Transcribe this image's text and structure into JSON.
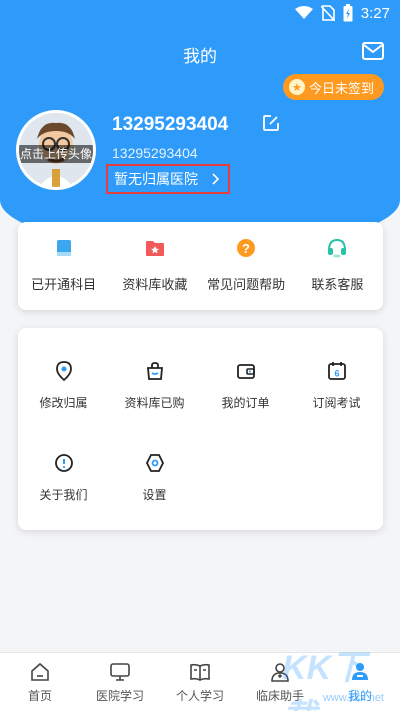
{
  "status_bar": {
    "time": "3:27"
  },
  "header": {
    "title": "我的",
    "signin_label": "今日未签到"
  },
  "profile": {
    "avatar_label": "点击上传头像",
    "username": "13295293404",
    "phone": "13295293404",
    "hospital_label": "暂无归属医院"
  },
  "quick_menu": [
    {
      "label": "已开通科目",
      "icon": "book-icon",
      "color": "#3aa7ee"
    },
    {
      "label": "资料库收藏",
      "icon": "star-folder-icon",
      "color": "#f25a5a"
    },
    {
      "label": "常见问题帮助",
      "icon": "question-icon",
      "color": "#ff9a21"
    },
    {
      "label": "联系客服",
      "icon": "headset-icon",
      "color": "#27c3a8"
    }
  ],
  "services": [
    {
      "label": "修改归属",
      "icon": "location-icon"
    },
    {
      "label": "资料库已购",
      "icon": "bag-icon"
    },
    {
      "label": "我的订单",
      "icon": "wallet-icon"
    },
    {
      "label": "订阅考试",
      "icon": "calendar-icon"
    },
    {
      "label": "关于我们",
      "icon": "info-icon"
    },
    {
      "label": "设置",
      "icon": "settings-icon"
    }
  ],
  "tabbar": [
    {
      "label": "首页",
      "icon": "home-icon"
    },
    {
      "label": "医院学习",
      "icon": "monitor-icon"
    },
    {
      "label": "个人学习",
      "icon": "open-book-icon"
    },
    {
      "label": "临床助手",
      "icon": "doctor-icon"
    },
    {
      "label": "我的",
      "icon": "user-icon",
      "active": true
    }
  ],
  "watermark": {
    "text": "KK下载",
    "url": "www.kkx.net"
  }
}
